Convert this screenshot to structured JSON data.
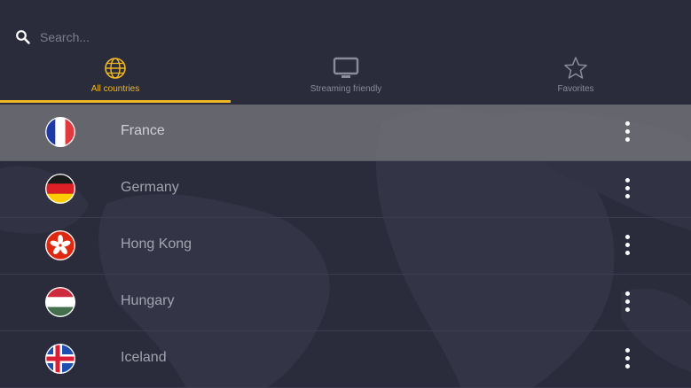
{
  "search": {
    "placeholder": "Search..."
  },
  "tabs": [
    {
      "label": "All countries",
      "icon": "globe-icon",
      "active": true
    },
    {
      "label": "Streaming friendly",
      "icon": "tv-icon",
      "active": false
    },
    {
      "label": "Favorites",
      "icon": "star-icon",
      "active": false
    }
  ],
  "countries": [
    {
      "name": "France",
      "flag": "france-flag-icon",
      "selected": true
    },
    {
      "name": "Germany",
      "flag": "germany-flag-icon",
      "selected": false
    },
    {
      "name": "Hong Kong",
      "flag": "hong-kong-flag-icon",
      "selected": false
    },
    {
      "name": "Hungary",
      "flag": "hungary-flag-icon",
      "selected": false
    },
    {
      "name": "Iceland",
      "flag": "iceland-flag-icon",
      "selected": false
    }
  ],
  "colors": {
    "background": "#2a2b3b",
    "accent": "#f0b823",
    "selected_row": "#76767c",
    "text": "#a2a4b0"
  }
}
